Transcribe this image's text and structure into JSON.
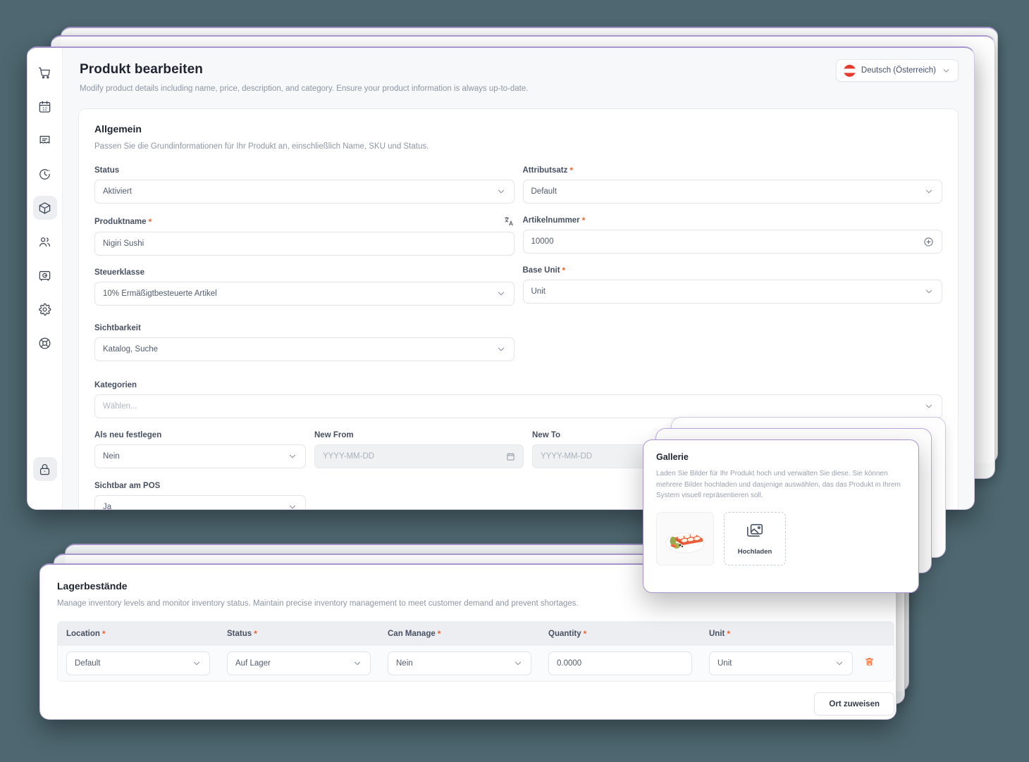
{
  "sidebar": {
    "items": [
      {
        "icon": "shopping-cart-icon",
        "name": "sidebar-item-orders"
      },
      {
        "icon": "calendar-icon",
        "name": "sidebar-item-calendar"
      },
      {
        "icon": "receipt-icon",
        "name": "sidebar-item-invoices"
      },
      {
        "icon": "clock-history-icon",
        "name": "sidebar-item-history"
      },
      {
        "icon": "package-icon",
        "name": "sidebar-item-products"
      },
      {
        "icon": "users-icon",
        "name": "sidebar-item-customers"
      },
      {
        "icon": "safe-icon",
        "name": "sidebar-item-safe"
      },
      {
        "icon": "gear-icon",
        "name": "sidebar-item-settings"
      },
      {
        "icon": "lifebuoy-icon",
        "name": "sidebar-item-support"
      }
    ],
    "bottom": {
      "icon": "lock-icon",
      "name": "sidebar-item-lock"
    }
  },
  "header": {
    "title": "Produkt bearbeiten",
    "subtitle": "Modify product details including name, price, description, and category. Ensure your product information is always up-to-date.",
    "language": {
      "label": "Deutsch (Österreich)",
      "flag": "austria-flag-icon",
      "chevron": "chevron-down-icon"
    }
  },
  "general": {
    "title": "Allgemein",
    "subtitle": "Passen Sie die Grundinformationen für Ihr Produkt an, einschließlich Name, SKU und Status.",
    "fields": {
      "status": {
        "label": "Status",
        "value": "Aktiviert",
        "required": false
      },
      "attribute_set": {
        "label": "Attributsatz",
        "value": "Default",
        "required": true
      },
      "product_name": {
        "label": "Produktname",
        "value": "Nigiri Sushi",
        "required": true,
        "trailing_icon": "translate-icon"
      },
      "sku": {
        "label": "Artikelnummer",
        "value": "10000",
        "required": true,
        "trailing_icon": "plus-circle-icon"
      },
      "tax_class": {
        "label": "Steuerklasse",
        "value": "10% Ermäßigtbesteuerte Artikel",
        "required": false
      },
      "base_unit": {
        "label": "Base Unit",
        "value": "Unit",
        "required": true
      },
      "visibility": {
        "label": "Sichtbarkeit",
        "value": "Katalog, Suche",
        "required": false
      },
      "categories": {
        "label": "Kategorien",
        "placeholder": "Wählen...",
        "required": false
      },
      "set_as_new": {
        "label": "Als neu festlegen",
        "value": "Nein",
        "required": false
      },
      "new_from": {
        "label": "New From",
        "placeholder": "YYYY-MM-DD",
        "required": false,
        "trailing_icon": "calendar-icon"
      },
      "new_to": {
        "label": "New To",
        "placeholder": "YYYY-MM-DD",
        "required": false,
        "trailing_icon": "calendar-icon"
      },
      "visible_pos": {
        "label": "Sichtbar am POS",
        "value": "Ja",
        "required": false
      }
    }
  },
  "gallery": {
    "title": "Gallerie",
    "subtitle": "Laden Sie Bilder für Ihr Produkt hoch und verwalten Sie diese. Sie können mehrere Bilder hochladen und dasjenige auswählen, das das Produkt in Ihrem System visuell repräsentieren soll.",
    "thumbnail_alt": "nigiri-sushi-thumbnail",
    "upload_label": "Hochladen",
    "upload_icon": "images-icon"
  },
  "inventory": {
    "title": "Lagerbestände",
    "subtitle": "Manage inventory levels and monitor inventory status. Maintain precise inventory management to meet customer demand and prevent shortages.",
    "columns": [
      {
        "label": "Location",
        "required": true
      },
      {
        "label": "Status",
        "required": true
      },
      {
        "label": "Can Manage",
        "required": true
      },
      {
        "label": "Quantity",
        "required": true
      },
      {
        "label": "Unit",
        "required": true
      }
    ],
    "rows": [
      {
        "location": "Default",
        "status": "Auf Lager",
        "can_manage": "Nein",
        "quantity": "0.0000",
        "unit": "Unit",
        "delete_icon": "trash-icon"
      }
    ],
    "assign_button": "Ort zuweisen"
  },
  "colors": {
    "background": "#4e6770",
    "card_accent": "#a995ce",
    "gallery_accent": "#ab93d0",
    "required_marker": "#f2622a",
    "delete": "#f2622a",
    "flag_red": "#e53b2c"
  }
}
